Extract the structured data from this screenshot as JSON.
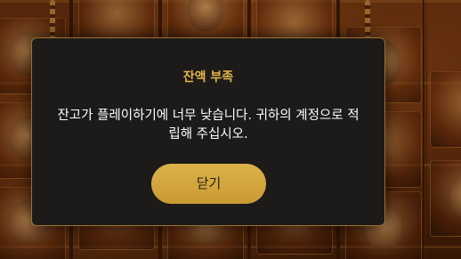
{
  "dialog": {
    "title": "잔액 부족",
    "message": "잔고가 플레이하기에 너무 낮습니다. 귀하의 계정으로 적립해 주십시오.",
    "close_label": "닫기"
  },
  "colors": {
    "title": "#e4b64c",
    "button": "#d4a83f",
    "dialog_bg": "#1d1b19",
    "dialog_border": "#9a7230"
  }
}
